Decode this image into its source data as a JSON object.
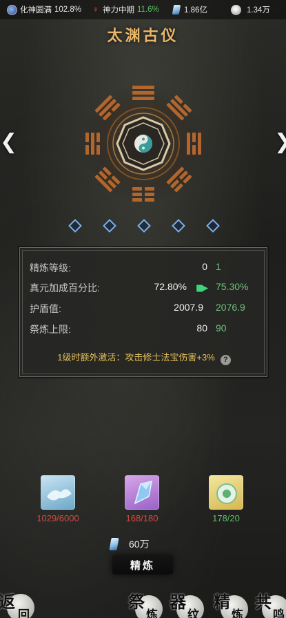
{
  "topbar": {
    "realm_label": "化神圆满",
    "realm_pct": "102.8%",
    "divine_label": "神力中期",
    "divine_pct": "11.6%",
    "crystal_amount": "1.86亿",
    "coin_amount": "1.34万"
  },
  "title": "太渊古仪",
  "gems_count": 5,
  "stats": {
    "refine_level": {
      "label": "精炼等级:",
      "current": "0",
      "next": "1"
    },
    "zhenyuan": {
      "label": "真元加成百分比:",
      "current": "72.80%",
      "next": "75.30%"
    },
    "shield": {
      "label": "护盾值:",
      "current": "2007.9",
      "next": "2076.9"
    },
    "limit": {
      "label": "祭炼上限:",
      "current": "80",
      "next": "90"
    },
    "bonus": "1级时额外激活：攻击修士法宝伤害+3%",
    "help_icon": "?"
  },
  "materials": [
    {
      "icon": "silk-fabric-icon",
      "count": "1029/6000",
      "color": "#d24a46"
    },
    {
      "icon": "blue-crystal-icon",
      "count": "168/180",
      "color": "#d24a46"
    },
    {
      "icon": "jade-treasure-icon",
      "count": "178/20",
      "color": "#5fbf6a"
    }
  ],
  "cost": {
    "amount": "60万"
  },
  "refine_button": "精炼",
  "nav": {
    "back": {
      "big": "返",
      "small": "回"
    },
    "sacrifice": {
      "big": "祭",
      "small": "炼"
    },
    "pattern": {
      "big": "器",
      "small": "纹"
    },
    "refine": {
      "big": "精",
      "small": "炼"
    },
    "resonance": {
      "big": "共",
      "small": "鸣"
    }
  },
  "colors": {
    "accent_gold": "#e9b76a",
    "gem_blue": "#7fb0e8",
    "positive_green": "#5fbf6a",
    "deficit_red": "#d24a46"
  }
}
